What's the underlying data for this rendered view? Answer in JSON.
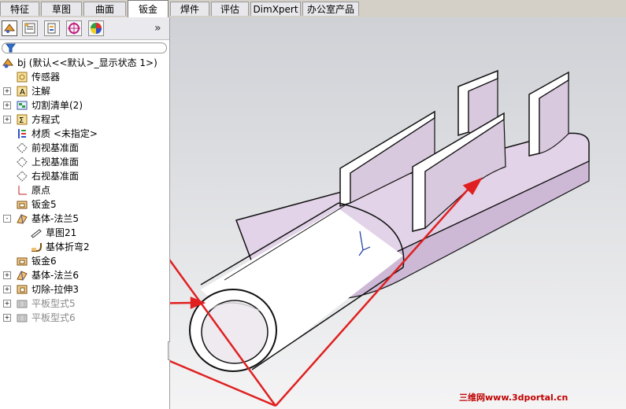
{
  "tabs": [
    "特征",
    "草图",
    "曲面",
    "钣金",
    "焊件",
    "评估",
    "DimXpert",
    "办公室产品"
  ],
  "active_tab": "钣金",
  "tree": {
    "root": "bj  (默认<<默认>_显示状态 1>)",
    "items": [
      {
        "label": "传感器",
        "icon": "sensor-icon",
        "expand": ""
      },
      {
        "label": "注解",
        "icon": "annotation-icon",
        "expand": "+"
      },
      {
        "label": "切割清单(2)",
        "icon": "cutlist-icon",
        "expand": "+"
      },
      {
        "label": "方程式",
        "icon": "equation-icon",
        "expand": "+"
      },
      {
        "label": "材质 <未指定>",
        "icon": "material-icon",
        "expand": ""
      },
      {
        "label": "前视基准面",
        "icon": "plane-icon",
        "expand": ""
      },
      {
        "label": "上视基准面",
        "icon": "plane-icon",
        "expand": ""
      },
      {
        "label": "右视基准面",
        "icon": "plane-icon",
        "expand": ""
      },
      {
        "label": "原点",
        "icon": "origin-icon",
        "expand": ""
      },
      {
        "label": "钣金5",
        "icon": "sheetmetal-icon",
        "expand": ""
      },
      {
        "label": "基体-法兰5",
        "icon": "base-flange-icon",
        "expand": "-"
      },
      {
        "label": "草图21",
        "icon": "sketch-icon",
        "expand": ""
      },
      {
        "label": "基体折弯2",
        "icon": "bend-icon",
        "expand": ""
      },
      {
        "label": "钣金6",
        "icon": "sheetmetal-icon",
        "expand": ""
      },
      {
        "label": "基体-法兰6",
        "icon": "base-flange-icon",
        "expand": "+"
      },
      {
        "label": "切除-拉伸3",
        "icon": "cut-extrude-icon",
        "expand": "+"
      },
      {
        "label": "平板型式5",
        "icon": "flat-pattern-icon",
        "expand": "+"
      },
      {
        "label": "平板型式6",
        "icon": "flat-pattern-icon",
        "expand": "+"
      }
    ]
  },
  "panel_tools": [
    "feature-manager-icon",
    "property-manager-icon",
    "configuration-manager-icon",
    "dimxpert-manager-icon",
    "display-manager-icon"
  ],
  "watermark": "三维网www.3dportal.cn",
  "colors": {
    "arrow": "#e02020",
    "model_face": "#d9cbe0",
    "model_edge": "#111111"
  }
}
